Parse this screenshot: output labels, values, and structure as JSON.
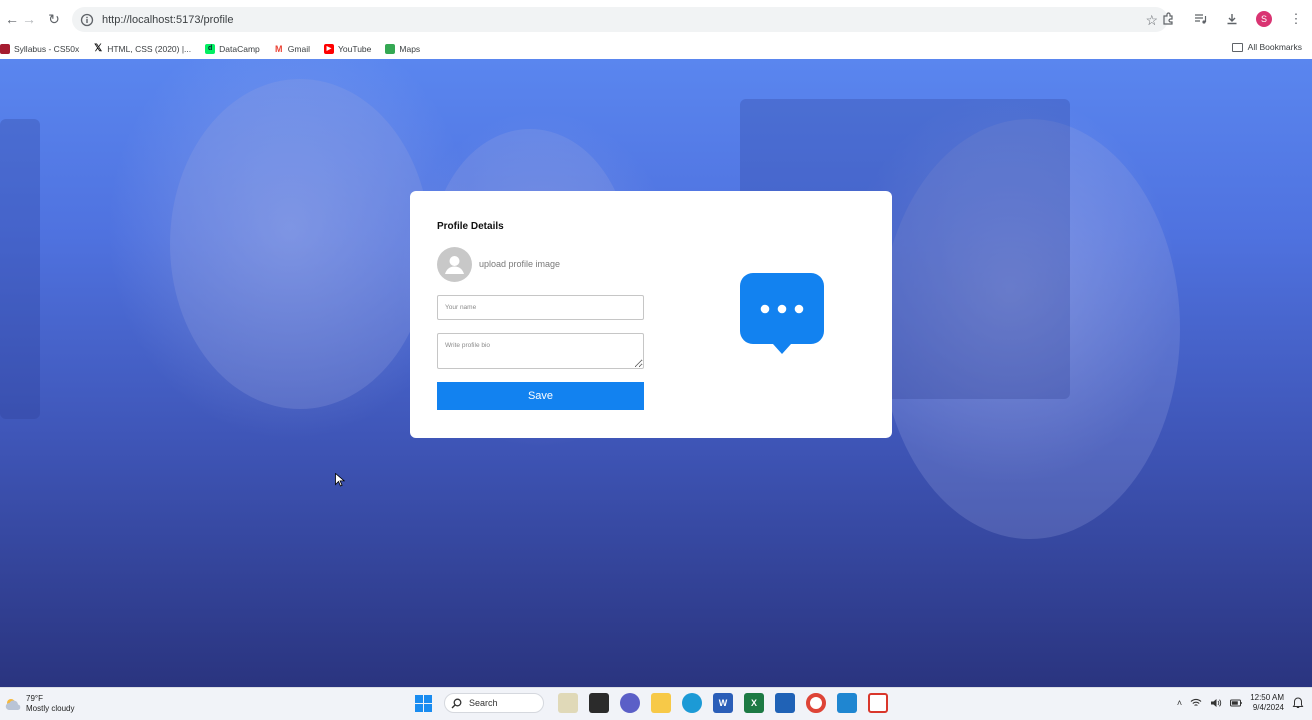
{
  "browser": {
    "url": "http://localhost:5173/profile",
    "profile_initial": "S",
    "bookmarks": [
      {
        "label": "Syllabus - CS50x",
        "icon": "harvard-shield-icon",
        "color": "#a51c30"
      },
      {
        "label": "HTML, CSS (2020) |...",
        "icon": "x-logo-icon",
        "color": "#111111"
      },
      {
        "label": "DataCamp",
        "icon": "datacamp-icon",
        "color": "#03ef62"
      },
      {
        "label": "Gmail",
        "icon": "gmail-icon",
        "color": "#ea4335"
      },
      {
        "label": "YouTube",
        "icon": "youtube-icon",
        "color": "#ff0000"
      },
      {
        "label": "Maps",
        "icon": "maps-icon",
        "color": "#34a853"
      }
    ],
    "all_bookmarks_label": "All Bookmarks"
  },
  "profile_card": {
    "title": "Profile Details",
    "upload_label": "upload profile image",
    "name_placeholder": "Your name",
    "bio_placeholder": "Write profile bio",
    "save_label": "Save",
    "accent_color": "#1282f0"
  },
  "taskbar": {
    "weather_temp": "79°F",
    "weather_desc": "Mostly cloudy",
    "search_label": "Search",
    "time": "12:50 AM",
    "date": "9/4/2024"
  }
}
